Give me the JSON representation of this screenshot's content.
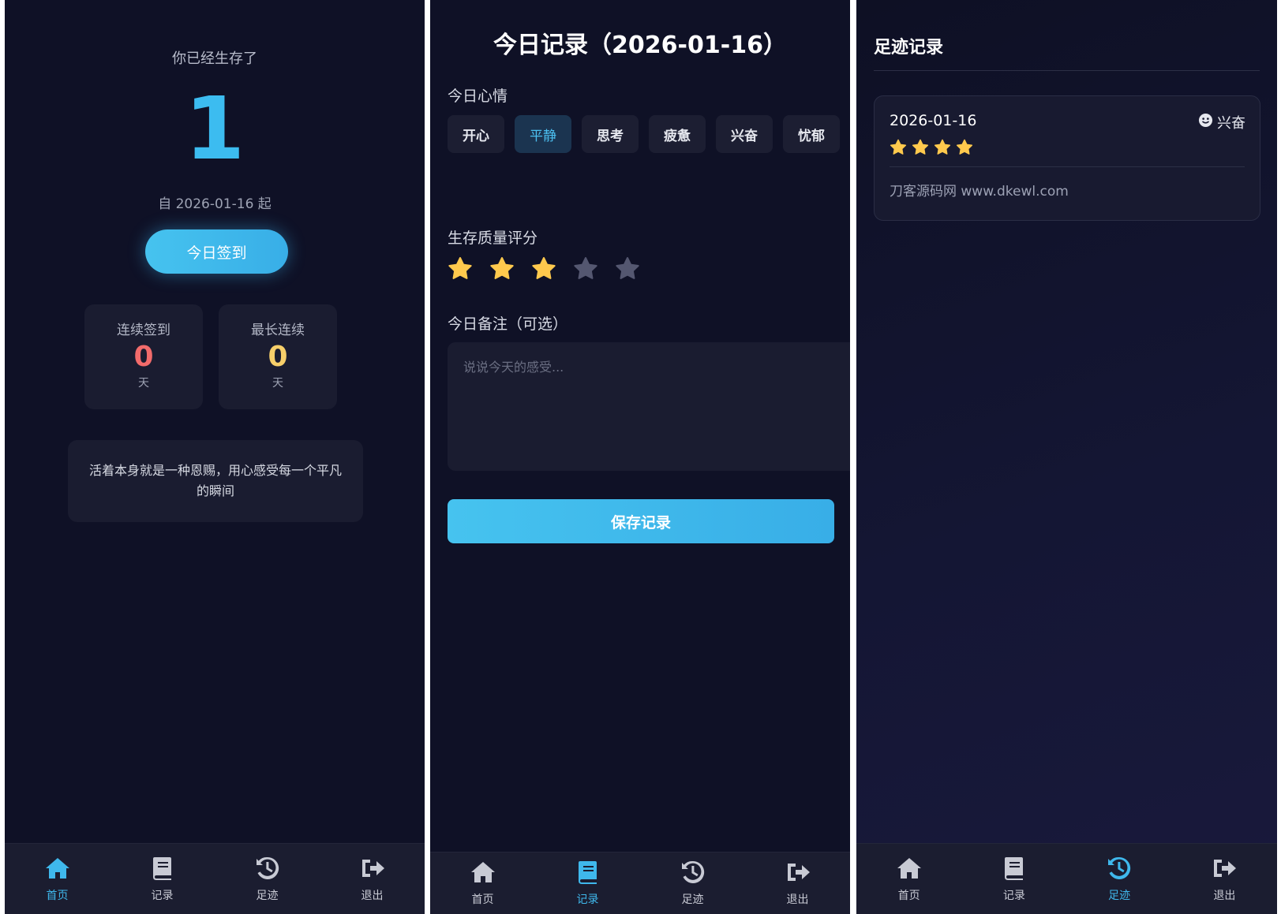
{
  "colors": {
    "accent": "#3cbcf0",
    "streak_current": "#f26b6b",
    "streak_longest": "#f7cf6a",
    "star_on": "#ffc94d",
    "star_off": "#545770"
  },
  "nav": {
    "items": [
      {
        "label": "首页",
        "icon": "home-icon"
      },
      {
        "label": "记录",
        "icon": "book-icon"
      },
      {
        "label": "足迹",
        "icon": "history-icon"
      },
      {
        "label": "退出",
        "icon": "sign-out-icon"
      }
    ]
  },
  "home": {
    "subtitle": "你已经生存了",
    "days": "1",
    "since": "自 2026-01-16 起",
    "checkin_label": "今日签到",
    "stats": [
      {
        "title": "连续签到",
        "value": "0",
        "unit": "天"
      },
      {
        "title": "最长连续",
        "value": "0",
        "unit": "天"
      }
    ],
    "quote": "活着本身就是一种恩赐，用心感受每一个平凡的瞬间"
  },
  "record": {
    "title": "今日记录（2026-01-16）",
    "mood_label": "今日心情",
    "moods": [
      "开心",
      "平静",
      "思考",
      "疲惫",
      "兴奋",
      "忧郁"
    ],
    "selected_mood": "平静",
    "rating_label": "生存质量评分",
    "rating": 3,
    "rating_max": 5,
    "note_label": "今日备注（可选）",
    "note_value": "",
    "note_placeholder": "说说今天的感受...",
    "save_label": "保存记录"
  },
  "footprints": {
    "title": "足迹记录",
    "entries": [
      {
        "date": "2026-01-16",
        "mood": "兴奋",
        "mood_icon": "smile-icon",
        "rating": 4,
        "note": "刀客源码网 www.dkewl.com"
      }
    ]
  }
}
